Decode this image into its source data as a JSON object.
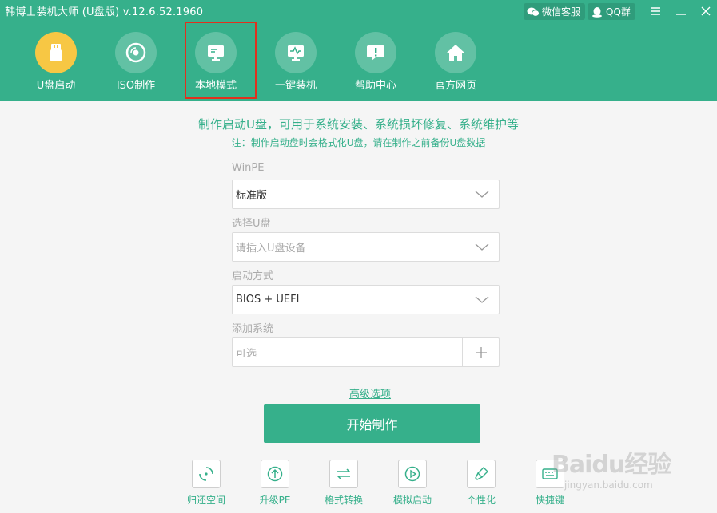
{
  "app": {
    "title": "韩博士装机大师 (U盘版) v.12.6.52.1960"
  },
  "top_buttons": {
    "wechat": "微信客服",
    "qq": "QQ群"
  },
  "nav": {
    "items": [
      {
        "label": "U盘启动",
        "icon": "usb-drive-icon"
      },
      {
        "label": "ISO制作",
        "icon": "disc-icon"
      },
      {
        "label": "本地模式",
        "icon": "monitor-icon"
      },
      {
        "label": "一键装机",
        "icon": "pulse-monitor-icon"
      },
      {
        "label": "帮助中心",
        "icon": "help-chat-icon"
      },
      {
        "label": "官方网页",
        "icon": "home-icon"
      }
    ],
    "active_index": 0,
    "highlighted_index": 2
  },
  "main": {
    "headline": "制作启动U盘，可用于系统安装、系统损坏修复、系统维护等",
    "note": "注：制作启动盘时会格式化U盘，请在制作之前备份U盘数据",
    "winpe": {
      "label": "WinPE",
      "value": "标准版"
    },
    "usb": {
      "label": "选择U盘",
      "placeholder": "请插入U盘设备"
    },
    "boot_mode": {
      "label": "启动方式",
      "value": "BIOS + UEFI"
    },
    "add_system": {
      "label": "添加系统",
      "placeholder": "可选"
    },
    "advanced_link": "高级选项",
    "start_button": "开始制作"
  },
  "tools": [
    {
      "label": "归还空间",
      "icon": "restore-space-icon"
    },
    {
      "label": "升级PE",
      "icon": "upgrade-icon"
    },
    {
      "label": "格式转换",
      "icon": "convert-icon"
    },
    {
      "label": "模拟启动",
      "icon": "play-icon"
    },
    {
      "label": "个性化",
      "icon": "brush-icon"
    },
    {
      "label": "快捷键",
      "icon": "keyboard-icon"
    }
  ],
  "watermark": {
    "text": "Baidu经验",
    "sub": "jingyan.baidu.com"
  },
  "colors": {
    "brand": "#36b08b",
    "accent_yellow": "#f7c744",
    "highlight_red": "#e0301e"
  }
}
